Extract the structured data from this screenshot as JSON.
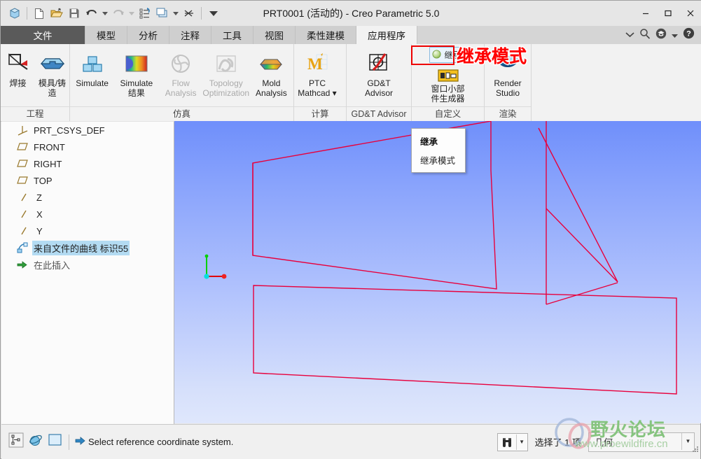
{
  "window": {
    "title": "PRT0001 (活动的) - Creo Parametric 5.0",
    "minimize": "—",
    "maximize": "▢",
    "close": "✕"
  },
  "quick_access": {
    "items": [
      {
        "name": "app-cube-icon",
        "label": ""
      },
      {
        "name": "new-file-icon",
        "label": ""
      },
      {
        "name": "open-folder-icon",
        "label": ""
      },
      {
        "name": "save-icon",
        "label": ""
      },
      {
        "name": "undo-icon",
        "label": ""
      },
      {
        "name": "undo-dropdown-icon",
        "label": ""
      },
      {
        "name": "redo-icon",
        "label": ""
      },
      {
        "name": "redo-dropdown-icon",
        "label": ""
      },
      {
        "name": "regenerate-icon",
        "label": ""
      },
      {
        "name": "window-switch-icon",
        "label": ""
      },
      {
        "name": "window-switch-dropdown-icon",
        "label": ""
      },
      {
        "name": "close-window-icon",
        "label": ""
      },
      {
        "name": "qat-overflow-icon",
        "label": ""
      }
    ]
  },
  "ribbon_tabs": [
    {
      "label": "文件",
      "state": "file"
    },
    {
      "label": "模型",
      "state": "normal"
    },
    {
      "label": "分析",
      "state": "normal"
    },
    {
      "label": "注释",
      "state": "normal"
    },
    {
      "label": "工具",
      "state": "normal"
    },
    {
      "label": "视图",
      "state": "normal"
    },
    {
      "label": "柔性建模",
      "state": "normal"
    },
    {
      "label": "应用程序",
      "state": "active"
    }
  ],
  "tabstrip_right": {
    "collapse_ribbon": "⌄",
    "search_icon": "search-icon",
    "learning_icon": "learning-connector-icon",
    "learning_dropdown": "▾",
    "help_icon": "help-icon"
  },
  "ribbon_groups": [
    {
      "label": "工程",
      "items": [
        {
          "label": "焊接",
          "icon": "weld-icon",
          "disabled": false
        },
        {
          "label": "模具/铸\n造",
          "icon": "mold-cast-icon",
          "disabled": false
        }
      ]
    },
    {
      "label": "仿真",
      "items": [
        {
          "label": "Simulate",
          "icon": "simulate-icon",
          "disabled": false
        },
        {
          "label": "Simulate\n结果",
          "icon": "simulate-results-icon",
          "disabled": false
        },
        {
          "label": "Flow\nAnalysis",
          "icon": "flow-analysis-icon",
          "disabled": true
        },
        {
          "label": "Topology\nOptimization",
          "icon": "topology-optimization-icon",
          "disabled": true
        },
        {
          "label": "Mold\nAnalysis",
          "icon": "mold-analysis-icon",
          "disabled": false
        }
      ]
    },
    {
      "label": "计算",
      "items": [
        {
          "label": "PTC\nMathcad ▾",
          "icon": "ptc-mathcad-icon",
          "disabled": false
        }
      ]
    },
    {
      "label": "GD&T Advisor",
      "items": [
        {
          "label": "GD&T\nAdvisor",
          "icon": "gdt-advisor-icon",
          "disabled": false
        }
      ]
    },
    {
      "label": "自定义",
      "items": [
        {
          "label": "继承",
          "icon": "inherit-icon",
          "disabled": false
        },
        {
          "label": "窗口小部\n件生成器",
          "icon": "widget-builder-icon",
          "disabled": false
        }
      ]
    },
    {
      "label": "渲染",
      "items": [
        {
          "label": "Render\nStudio",
          "icon": "render-studio-icon",
          "disabled": false
        }
      ]
    }
  ],
  "annotation": {
    "text": "继承模式",
    "color": "#ff0000",
    "highlight_color": "#ee0000"
  },
  "model_tree": {
    "rows": [
      {
        "label": "PRT_CSYS_DEF",
        "icon": "coordinate-system-icon",
        "selected": false
      },
      {
        "label": "FRONT",
        "icon": "datum-plane-icon",
        "selected": false
      },
      {
        "label": "RIGHT",
        "icon": "datum-plane-icon",
        "selected": false
      },
      {
        "label": "TOP",
        "icon": "datum-plane-icon",
        "selected": false
      },
      {
        "label": "Z",
        "icon": "datum-axis-icon",
        "selected": false
      },
      {
        "label": "X",
        "icon": "datum-axis-icon",
        "selected": false
      },
      {
        "label": "Y",
        "icon": "datum-axis-icon",
        "selected": false
      },
      {
        "label": "来自文件的曲线 标识55",
        "icon": "curve-from-file-icon",
        "selected": true
      },
      {
        "label": "在此插入",
        "icon": "insert-here-arrow-icon",
        "selected": false
      }
    ]
  },
  "viewport": {
    "tooltip": {
      "title": "继承",
      "description": "继承模式"
    },
    "background_top": "#6f8ffb",
    "background_bottom": "#dfe7fc",
    "geometry_color": "#e8003c"
  },
  "status_bar": {
    "left_icons": [
      {
        "name": "selection-filter-icon"
      },
      {
        "name": "globe-icon"
      },
      {
        "name": "display-style-icon"
      }
    ],
    "message": "Select reference coordinate system.",
    "message_arrow_icon": "arrow-right-icon",
    "find_icon": "binoculars-icon",
    "find_dropdown": "▾",
    "selection_count": "选择了 1 项",
    "filter_label": "几何",
    "filter_dropdown": "▾"
  },
  "watermark": {
    "brand": "野火论坛",
    "url": "www.proewildfire.cn"
  }
}
